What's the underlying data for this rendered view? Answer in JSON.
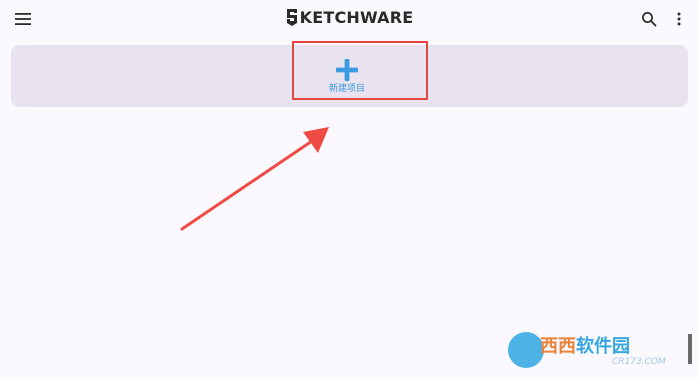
{
  "app": {
    "brand_prefix": "S",
    "brand_rest": "KETCHWARE"
  },
  "toolbar": {
    "menu_icon": "hamburger-menu-icon",
    "search_icon": "search-icon",
    "more_icon": "more-vert-icon"
  },
  "new_project": {
    "icon": "plus-icon",
    "label": "新建项目",
    "icon_color": "#3a9be0"
  },
  "annotation": {
    "highlight_color": "#e8453c"
  },
  "watermark": {
    "text_orange": "西西",
    "text_blue": "软件园",
    "sub": "CR173.COM"
  }
}
